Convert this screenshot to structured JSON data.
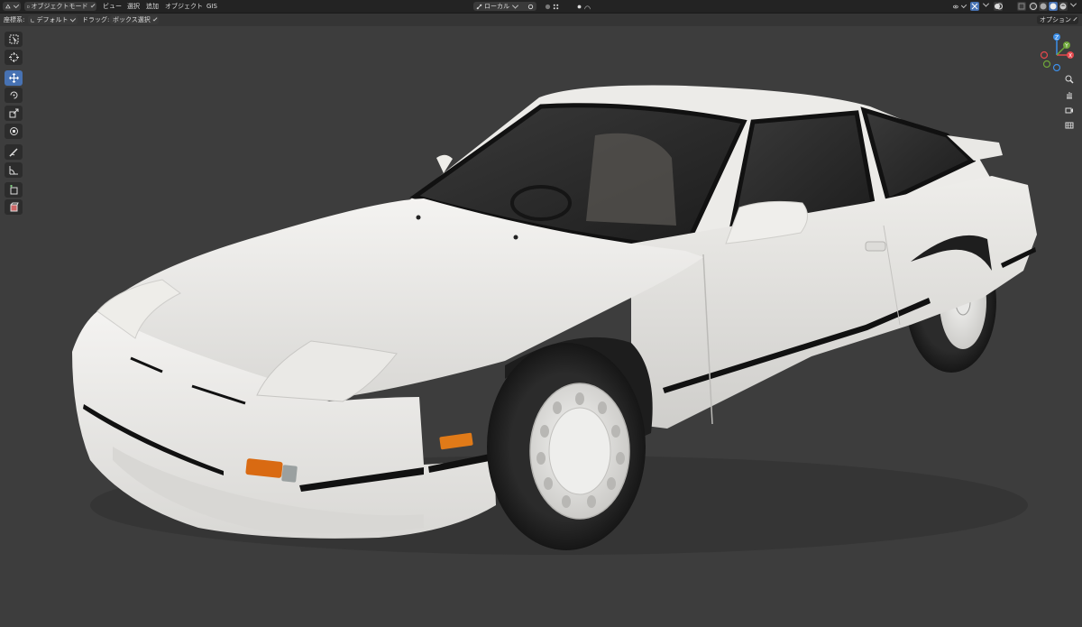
{
  "header": {
    "editor_icon": "editor-type-icon",
    "mode_label": "オブジェクトモード",
    "menus": [
      "ビュー",
      "選択",
      "追加",
      "オブジェクト",
      "GIS"
    ],
    "transform_orientation": "ローカル",
    "options_label": "オプション"
  },
  "toolsettings": {
    "coord_label": "座標系:",
    "coord_value": "デフォルト",
    "drag_label": "ドラッグ:",
    "drag_value": "ボックス選択"
  },
  "toolbar": {
    "tools": [
      "select-box-icon",
      "cursor-icon",
      "move-icon",
      "rotate-icon",
      "scale-icon",
      "transform-icon",
      "annotate-icon",
      "measure-icon",
      "add-cube-icon",
      "add-object-icon"
    ],
    "active_tool": "move-icon"
  },
  "gizmo": {
    "axes": [
      "Z",
      "X",
      "Y"
    ],
    "colors": {
      "x": "#e5484d",
      "y": "#6fa63a",
      "z": "#3d8fe8"
    }
  },
  "nav_buttons": [
    "zoom-icon",
    "hand-pan-icon",
    "camera-icon",
    "grid-view-icon"
  ],
  "scene": {
    "object": "white-sports-car",
    "car_color": "#f2f1ee",
    "background": "#3d3d3d"
  }
}
